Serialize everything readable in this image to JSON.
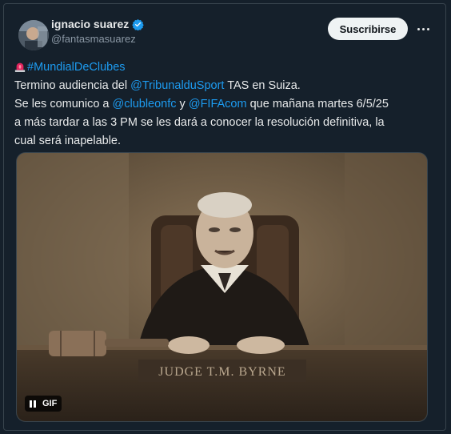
{
  "author": {
    "name": "ignacio suarez",
    "handle": "@fantasmasuarez"
  },
  "actions": {
    "subscribe_label": "Suscribirse"
  },
  "post": {
    "hashtag": "#MundialDeClubes",
    "line1_a": "Termino audiencia del ",
    "line1_mention": "@TribunalduSport",
    "line1_b": " TAS en Suiza.",
    "line2_a": "Se les comunico a ",
    "line2_mention1": "@clubleonfc",
    "line2_mid": " y ",
    "line2_mention2": "@FIFAcom",
    "line2_b": " que mañana martes 6/5/25",
    "line3": "a más tardar a las 3 PM se les dará a conocer la resolución definitiva, la",
    "line4": "cual será inapelable."
  },
  "media": {
    "gif_label": "GIF",
    "nameplate_text": "JUDGE T.M. BYRNE"
  },
  "colors": {
    "background": "#15202b",
    "link": "#1d9bf0",
    "verified": "#1d9bf0",
    "text": "#e7e9ea",
    "muted": "#8b98a5"
  },
  "icons": [
    "siren-icon",
    "verified-badge-icon",
    "more-options-icon",
    "pause-icon"
  ]
}
